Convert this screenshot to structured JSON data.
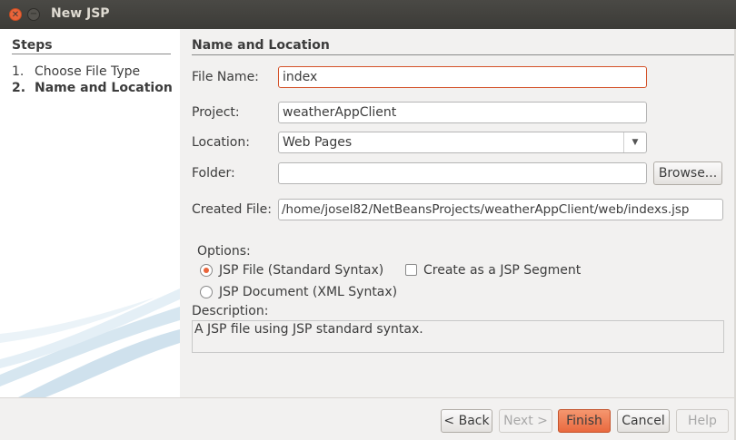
{
  "window": {
    "title": "New JSP"
  },
  "steps": {
    "title": "Steps",
    "items": [
      {
        "num": "1.",
        "label": "Choose File Type"
      },
      {
        "num": "2.",
        "label": "Name and Location"
      }
    ]
  },
  "form": {
    "heading": "Name and Location",
    "file_name": {
      "label": "File Name:",
      "value": "index"
    },
    "project": {
      "label": "Project:",
      "value": "weatherAppClient"
    },
    "location": {
      "label": "Location:",
      "value": "Web Pages"
    },
    "folder": {
      "label": "Folder:",
      "value": "",
      "browse_label": "Browse..."
    },
    "created_file": {
      "label": "Created File:",
      "value": "/home/josel82/NetBeansProjects/weatherAppClient/web/indexs.jsp"
    }
  },
  "options": {
    "label": "Options:",
    "jsp_file": {
      "label": "JSP File (Standard Syntax)",
      "selected": true
    },
    "jsp_document": {
      "label": "JSP Document (XML Syntax)",
      "selected": false
    },
    "segment": {
      "label": "Create as a JSP Segment",
      "checked": false
    }
  },
  "description": {
    "label": "Description:",
    "text": "A JSP file using JSP standard syntax."
  },
  "buttons": {
    "back": "< Back",
    "next": "Next >",
    "finish": "Finish",
    "cancel": "Cancel",
    "help": "Help"
  },
  "colors": {
    "accent": "#e9643a",
    "titlebar": "#3c3b37"
  }
}
